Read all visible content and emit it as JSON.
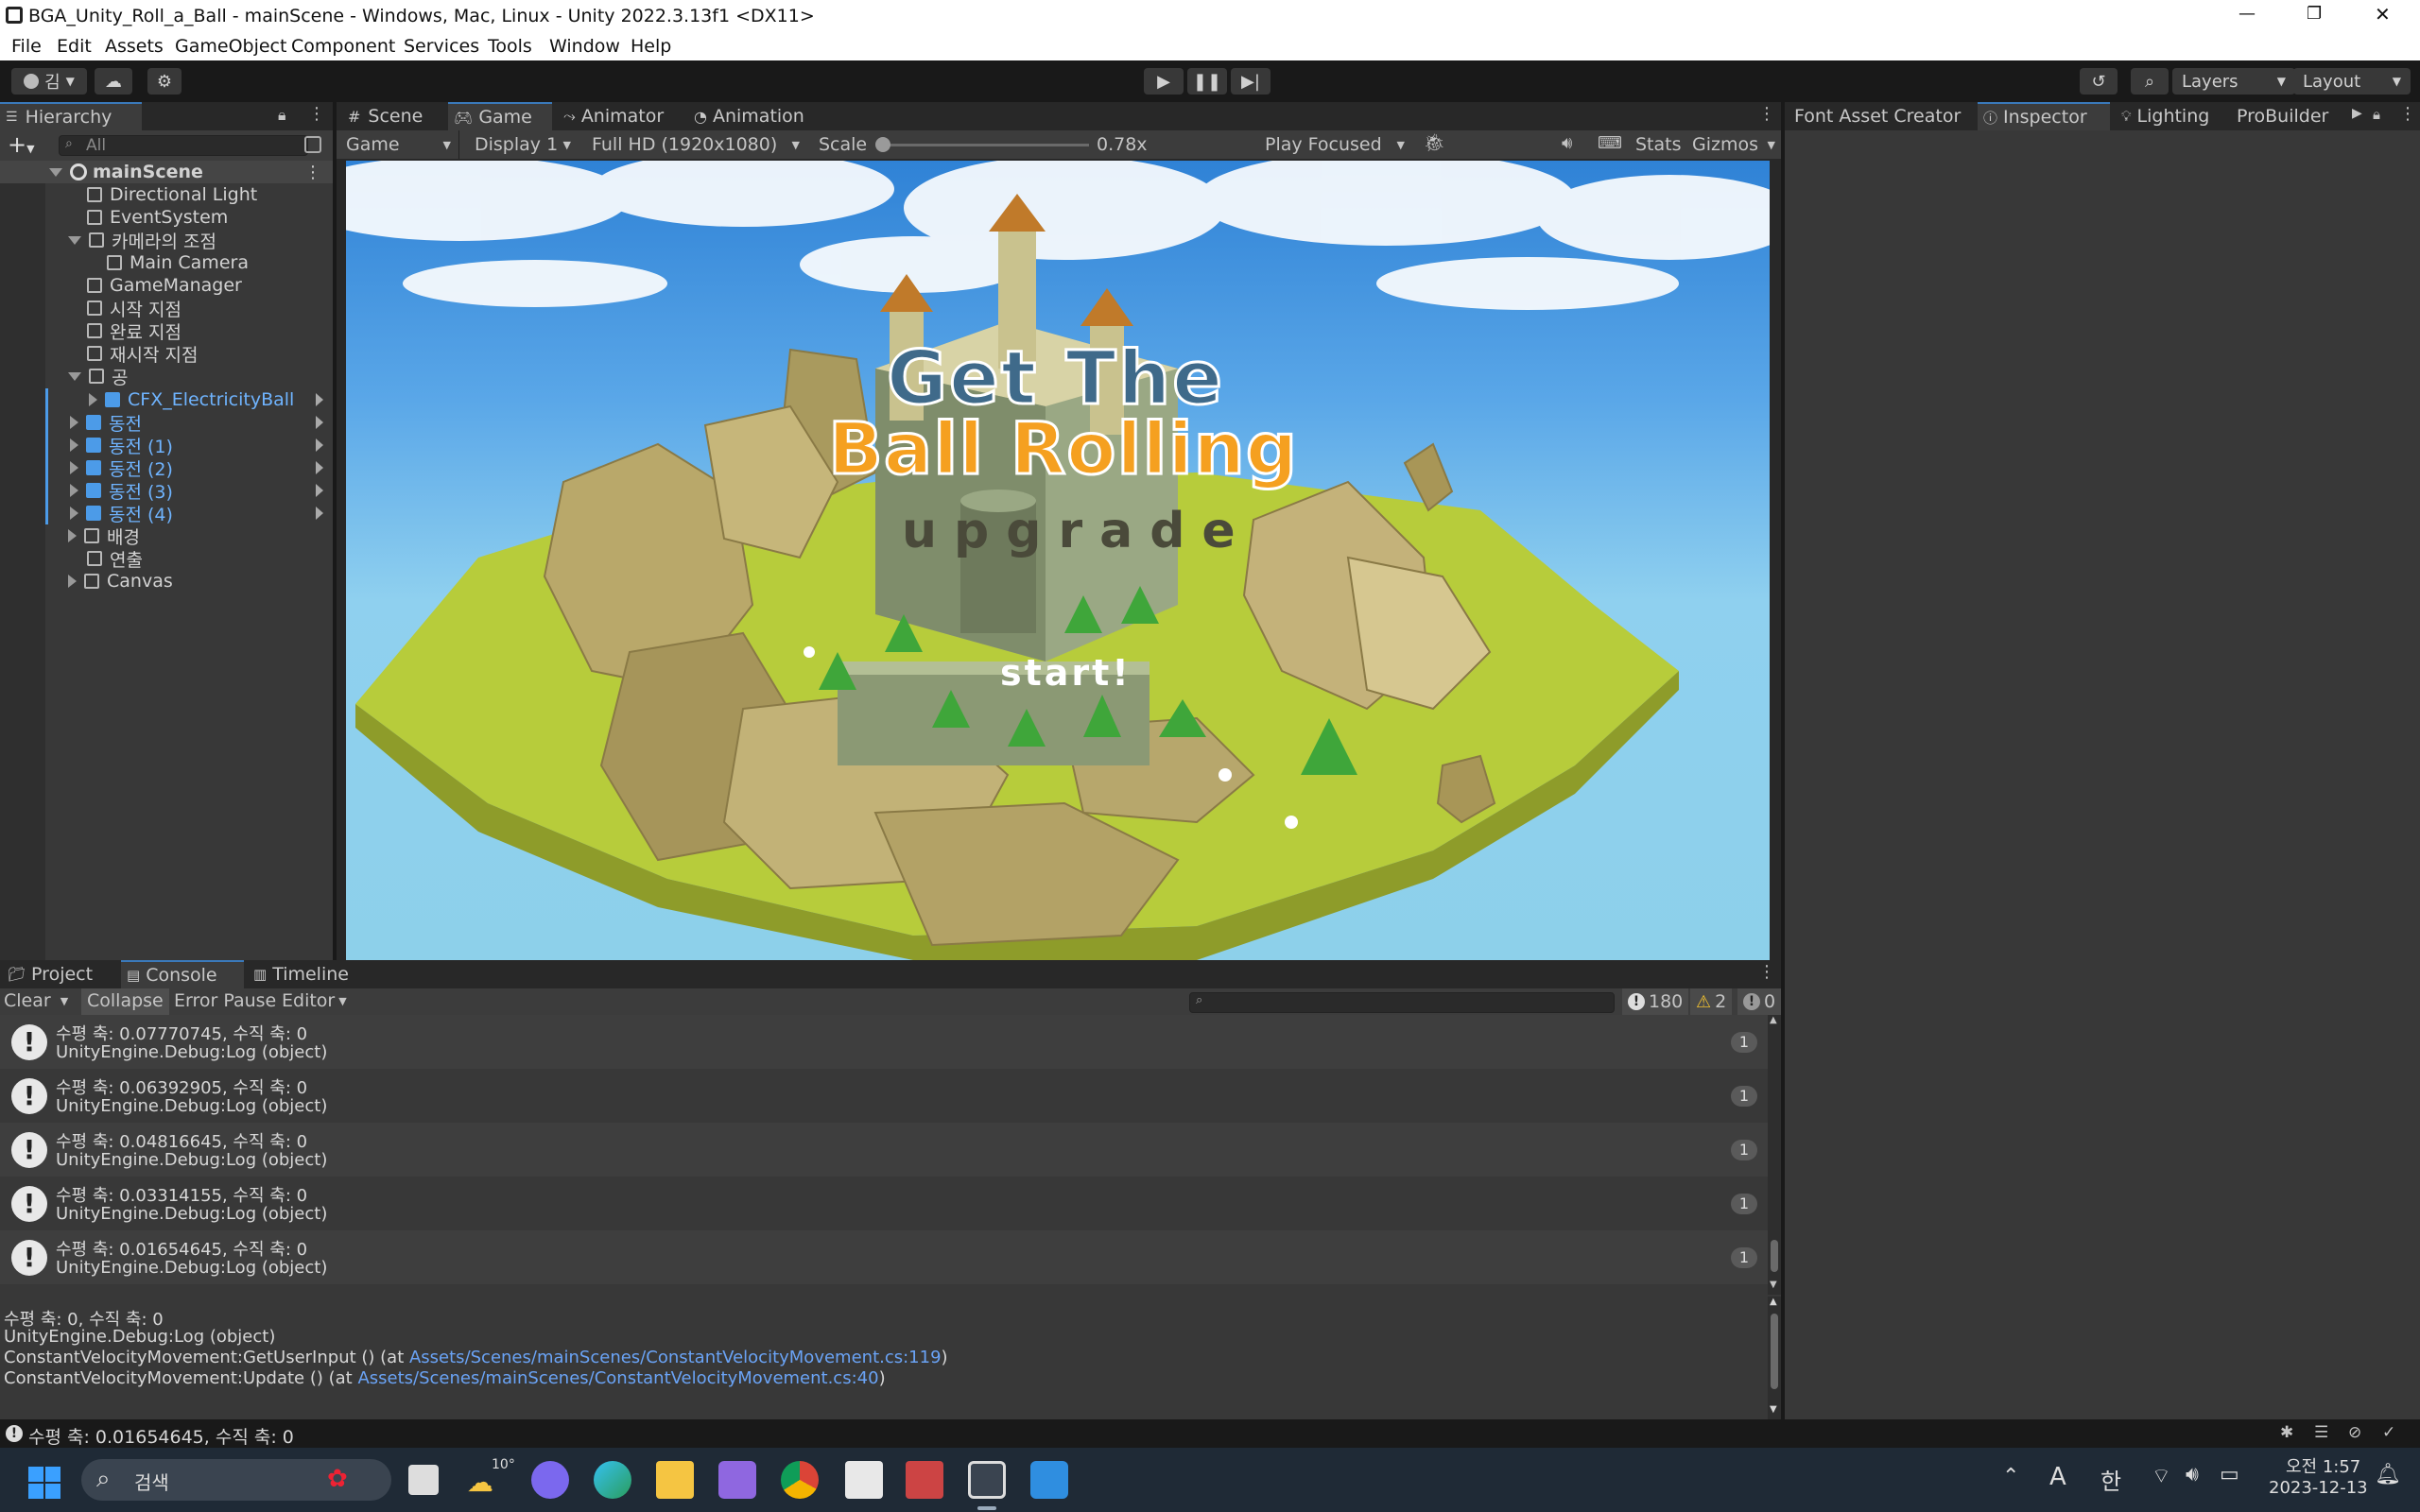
{
  "window": {
    "title": "BGA_Unity_Roll_a_Ball - mainScene - Windows, Mac, Linux - Unity 2022.3.13f1 <DX11>",
    "controls": [
      "—",
      "❐",
      "✕"
    ]
  },
  "menu": [
    "File",
    "Edit",
    "Assets",
    "GameObject",
    "Component",
    "Services",
    "Tools",
    "Window",
    "Help"
  ],
  "toolbar": {
    "account": "김",
    "layers": "Layers",
    "layout": "Layout"
  },
  "hierarchy": {
    "tab": "Hierarchy",
    "search_placeholder": "All",
    "scene": "mainScene",
    "items": [
      {
        "label": "Directional Light"
      },
      {
        "label": "EventSystem"
      },
      {
        "label": "카메라의 조점"
      },
      {
        "label": "Main Camera"
      },
      {
        "label": "GameManager"
      },
      {
        "label": "시작 지점"
      },
      {
        "label": "완료 지점"
      },
      {
        "label": "재시작 지점"
      },
      {
        "label": "공"
      },
      {
        "label": "CFX_ElectricityBall"
      },
      {
        "label": "동전"
      },
      {
        "label": "동전 (1)"
      },
      {
        "label": "동전 (2)"
      },
      {
        "label": "동전 (3)"
      },
      {
        "label": "동전 (4)"
      },
      {
        "label": "배경"
      },
      {
        "label": "연출"
      },
      {
        "label": "Canvas"
      }
    ]
  },
  "center_tabs": [
    "Scene",
    "Game",
    "Animator",
    "Animation"
  ],
  "game_toolbar": {
    "view": "Game",
    "display": "Display 1",
    "resolution": "Full HD (1920x1080)",
    "scale_label": "Scale",
    "scale_value": "0.78x",
    "play_mode": "Play Focused",
    "stats": "Stats",
    "gizmos": "Gizmos",
    "scale_fraction": 0.0
  },
  "game_view": {
    "title_line1": "Get The",
    "title_line2": "Ball Rolling",
    "subtitle": "upgrade",
    "start": "start!"
  },
  "right_tabs": [
    "Font Asset Creator",
    "Inspector",
    "Lighting",
    "ProBuilder"
  ],
  "bottom_tabs": [
    "Project",
    "Console",
    "Timeline"
  ],
  "console_toolbar": {
    "clear": "Clear",
    "collapse": "Collapse",
    "error_pause": "Error Pause",
    "editor": "Editor",
    "count_log": "180",
    "count_warn": "2",
    "count_err": "0"
  },
  "logs": [
    {
      "line1": "수평 축: 0.07770745, 수직 축: 0",
      "line2": "UnityEngine.Debug:Log (object)",
      "count": "1"
    },
    {
      "line1": "수평 축: 0.06392905, 수직 축: 0",
      "line2": "UnityEngine.Debug:Log (object)",
      "count": "1"
    },
    {
      "line1": "수평 축: 0.04816645, 수직 축: 0",
      "line2": "UnityEngine.Debug:Log (object)",
      "count": "1"
    },
    {
      "line1": "수평 축: 0.03314155, 수직 축: 0",
      "line2": "UnityEngine.Debug:Log (object)",
      "count": "1"
    },
    {
      "line1": "수평 축: 0.01654645, 수직 축: 0",
      "line2": "UnityEngine.Debug:Log (object)",
      "count": "1"
    }
  ],
  "detail": {
    "l1": "수평 축: 0, 수직 축: 0",
    "l2": "UnityEngine.Debug:Log (object)",
    "l3_pre": "ConstantVelocityMovement:GetUserInput () (at ",
    "l3_link": "Assets/Scenes/mainScenes/ConstantVelocityMovement.cs:119",
    "l3_post": ")",
    "l4_pre": "ConstantVelocityMovement:Update () (at ",
    "l4_link": "Assets/Scenes/mainScenes/ConstantVelocityMovement.cs:40",
    "l4_post": ")"
  },
  "status_bar": "수평 축: 0.01654645, 수직 축: 0",
  "taskbar": {
    "search": "검색",
    "weather": "10°",
    "ime_a": "A",
    "ime_han": "한",
    "time": "오전 1:57",
    "date": "2023-12-13"
  }
}
